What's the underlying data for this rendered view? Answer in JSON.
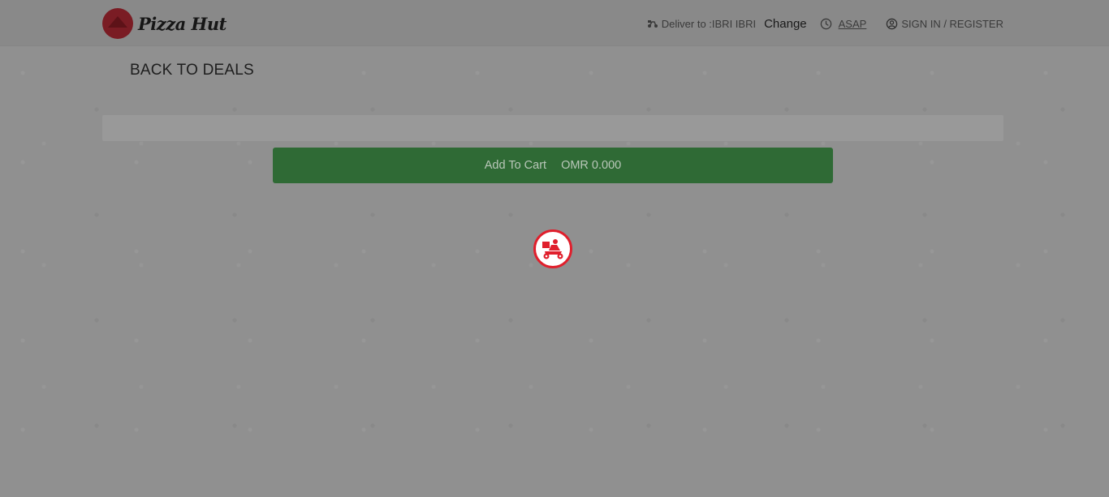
{
  "header": {
    "brand": "Pizza Hut",
    "deliver_label": "Deliver to :IBRI IBRI",
    "change_label": "Change",
    "time_label": "ASAP",
    "signin_label": "SIGN IN / REGISTER"
  },
  "page": {
    "back_label": "BACK TO DEALS"
  },
  "cart": {
    "button_label": "Add To Cart",
    "price": "OMR 0.000"
  },
  "icons": {
    "delivery": "scooter-icon",
    "clock": "clock-icon",
    "user": "user-icon",
    "loader": "delivery-scooter-loader-icon"
  },
  "colors": {
    "brand_red": "#e01f2c",
    "cart_green": "#2f6a35"
  }
}
